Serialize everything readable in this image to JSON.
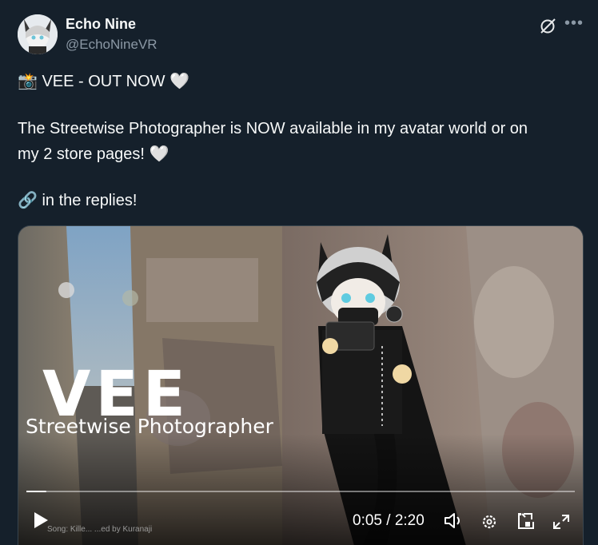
{
  "author": {
    "name": "Echo Nine",
    "handle": "@EchoNineVR"
  },
  "post": {
    "line1": "📸 VEE - OUT NOW 🤍",
    "line2": "The Streetwise Photographer is NOW available in my avatar world or on",
    "line3": "my 2 store pages! 🤍",
    "line4": "🔗 in the replies!"
  },
  "video": {
    "overlay_title": "VEE",
    "overlay_subtitle": "Streetwise Photographer",
    "song_credit": "Song: Kille...  ...ed by Kuranaji",
    "time_display": "0:05 / 2:20",
    "progress": 0.036
  },
  "icons": {
    "grok": "grok-icon",
    "more": "more-icon",
    "play": "play-icon",
    "volume": "volume-icon",
    "settings": "settings-icon",
    "pip": "pip-icon",
    "fullscreen": "fullscreen-icon"
  }
}
